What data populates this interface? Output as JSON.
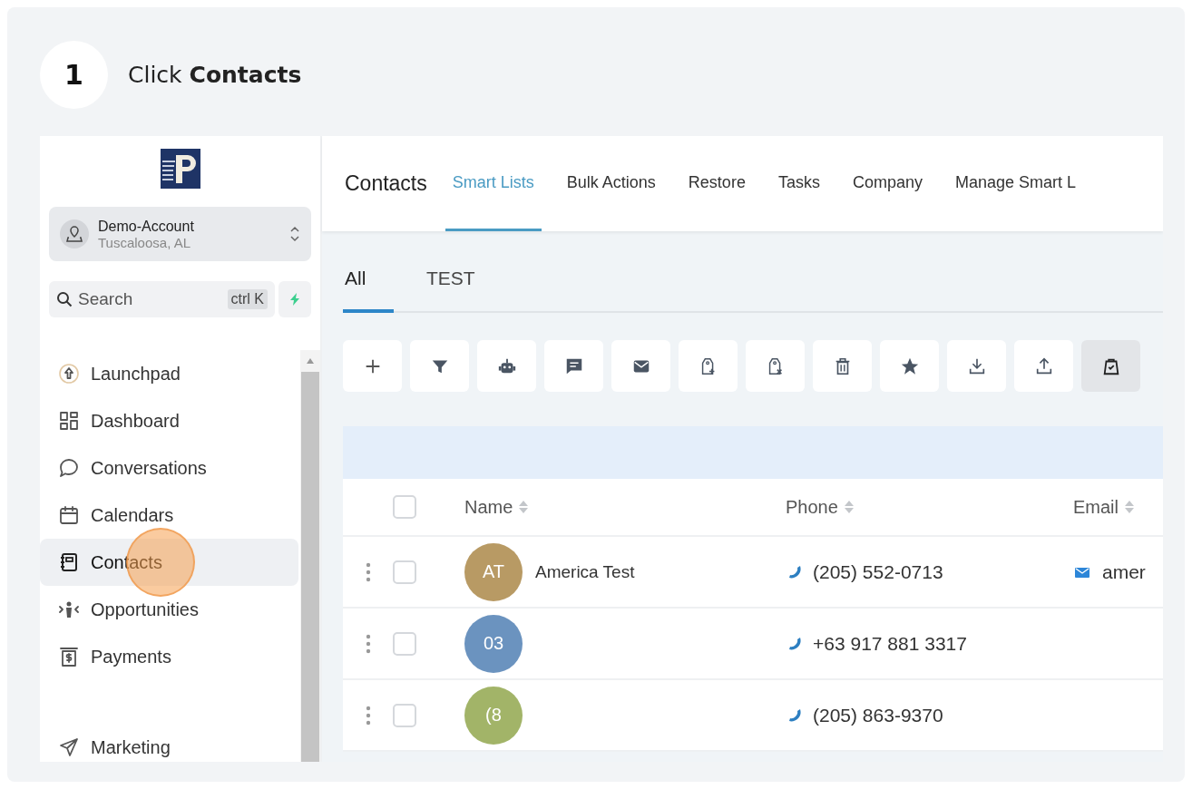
{
  "step": {
    "number": "1",
    "instruction": "Click **Contacts**"
  },
  "sidebar": {
    "account": {
      "name": "Demo-Account",
      "location": "Tuscaloosa, AL"
    },
    "search": {
      "placeholder": "Search",
      "shortcut": "ctrl K"
    },
    "items": [
      {
        "label": "Launchpad",
        "kind": "rocket",
        "selected": false,
        "clicked": false
      },
      {
        "label": "Dashboard",
        "kind": "grid",
        "selected": false,
        "clicked": false
      },
      {
        "label": "Conversations",
        "kind": "chat",
        "selected": false,
        "clicked": false
      },
      {
        "label": "Calendars",
        "kind": "calendar",
        "selected": false,
        "clicked": false
      },
      {
        "label": "Contacts",
        "kind": "book",
        "selected": true,
        "clicked": true
      },
      {
        "label": "Opportunities",
        "kind": "people",
        "selected": false,
        "clicked": false
      },
      {
        "label": "Payments",
        "kind": "dollar",
        "selected": false,
        "clicked": false
      }
    ],
    "footer_items": [
      {
        "label": "Marketing",
        "kind": "send",
        "selected": false,
        "clicked": false
      }
    ]
  },
  "header": {
    "title": "Contacts",
    "tabs": [
      {
        "label": "Smart Lists",
        "selected": true
      },
      {
        "label": "Bulk Actions",
        "selected": false
      },
      {
        "label": "Restore",
        "selected": false
      },
      {
        "label": "Tasks",
        "selected": false
      },
      {
        "label": "Company",
        "selected": false
      },
      {
        "label": "Manage Smart L",
        "selected": false
      }
    ]
  },
  "list_tabs": [
    {
      "label": "All",
      "selected": true
    },
    {
      "label": "TEST",
      "selected": false
    }
  ],
  "toolbar": [
    {
      "kind": "plus",
      "selected": false
    },
    {
      "kind": "filter",
      "selected": false
    },
    {
      "kind": "robot",
      "selected": false
    },
    {
      "kind": "message",
      "selected": false
    },
    {
      "kind": "mail",
      "selected": false
    },
    {
      "kind": "tagadd",
      "selected": false
    },
    {
      "kind": "tagremove",
      "selected": false
    },
    {
      "kind": "trash",
      "selected": false
    },
    {
      "kind": "star",
      "selected": false
    },
    {
      "kind": "download",
      "selected": false
    },
    {
      "kind": "upload",
      "selected": false
    },
    {
      "kind": "bag",
      "selected": true
    }
  ],
  "table": {
    "header_checked": false,
    "columns": [
      "Name",
      "Phone",
      "Email"
    ],
    "rows": [
      {
        "initials": "AT",
        "color": "#b89a64",
        "name": "America Test",
        "phone": "(205) 552-0713",
        "email": "amer",
        "checked": false
      },
      {
        "initials": "03",
        "color": "#6b93bf",
        "phone": "+63 917 881 3317",
        "checked": false
      },
      {
        "initials": "(8",
        "color": "#a2b468",
        "phone": "(205) 863-9370",
        "checked": false
      }
    ]
  }
}
